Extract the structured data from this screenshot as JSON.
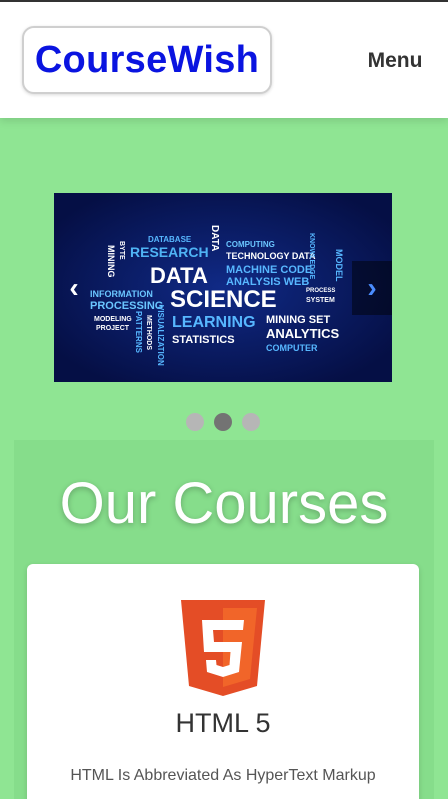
{
  "navbar": {
    "logo_text": "CourseWish",
    "menu_label": "Menu",
    "logo_color": "#0a14e0"
  },
  "carousel": {
    "prev_symbol": "‹",
    "next_symbol": "›",
    "slides": 3,
    "active_slide": 2,
    "words": {
      "database": "DATABASE",
      "research": "RESEARCH",
      "computing": "COMPUTING",
      "technology_data": "TECHNOLOGY DATA",
      "data_vertical": "DATA",
      "data": "DATA",
      "science": "SCIENCE",
      "machine_code": "MACHINE CODE",
      "analysis_web": "ANALYSIS WEB",
      "information": "INFORMATION",
      "processing": "PROCESSING",
      "learning": "LEARNING",
      "modeling": "MODELING",
      "project": "PROJECT",
      "statistics": "STATISTICS",
      "mining_set": "MINING SET",
      "analytics": "ANALYTICS",
      "computer": "COMPUTER",
      "process": "PROCESS",
      "system": "SYSTEM",
      "model": "MODEL",
      "byte": "BYTE",
      "mining": "MINING",
      "patterns": "PATTERNS",
      "visualization": "VISUALIZATION",
      "knowledge": "KNOWLEDGE",
      "methods": "METHODS"
    }
  },
  "courses": {
    "title": "Our Courses",
    "items": [
      {
        "icon": "html5-icon",
        "title": "HTML 5",
        "description": "HTML Is Abbreviated As HyperText Markup"
      }
    ]
  }
}
